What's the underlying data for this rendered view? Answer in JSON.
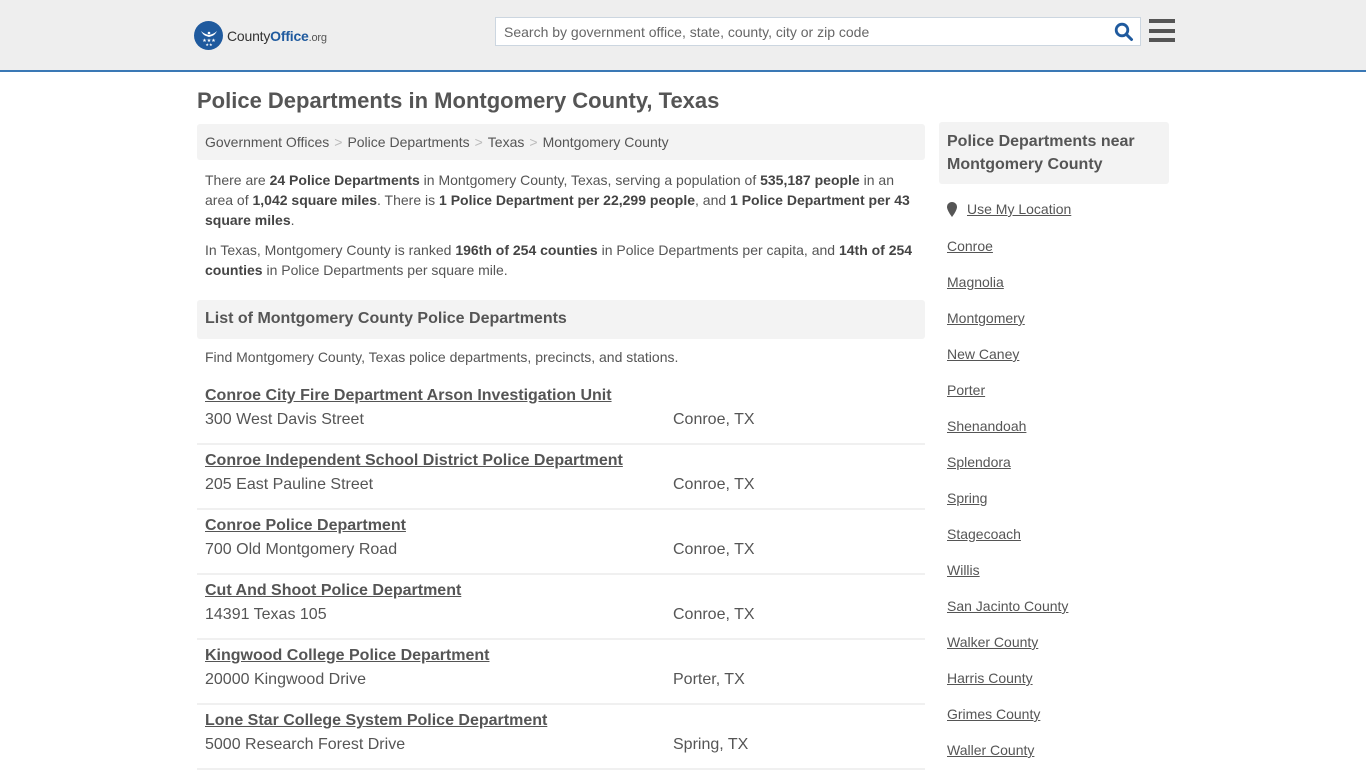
{
  "header": {
    "logo": {
      "name_part1": "County",
      "name_part2": "Office",
      "name_part3": ".org"
    },
    "search_placeholder": "Search by government office, state, county, city or zip code",
    "search_value": "",
    "colors": {
      "brand": "#1f5a9e",
      "header_border": "#3a78b5",
      "header_bg": "#eeeeee"
    }
  },
  "page_title": "Police Departments in Montgomery County, Texas",
  "breadcrumb": [
    {
      "label": "Government Offices"
    },
    {
      "label": "Police Departments"
    },
    {
      "label": "Texas"
    },
    {
      "label": "Montgomery County"
    }
  ],
  "breadcrumb_separator": ">",
  "intro": {
    "p1": {
      "t1": "There are ",
      "b1": "24 Police Departments",
      "t2": " in Montgomery County, Texas, serving a population of ",
      "b2": "535,187 people",
      "t3": " in an area of ",
      "b3": "1,042 square miles",
      "t4": ". There is ",
      "b4": "1 Police Department per 22,299 people",
      "t5": ", and ",
      "b5": "1 Police Department per 43 square miles",
      "t6": "."
    },
    "p2": {
      "t1": "In Texas, Montgomery County is ranked ",
      "b1": "196th of 254 counties",
      "t2": " in Police Departments per capita, and ",
      "b2": "14th of 254 counties",
      "t3": " in Police Departments per square mile."
    }
  },
  "list": {
    "title": "List of Montgomery County Police Departments",
    "description": "Find Montgomery County, Texas police departments, precincts, and stations.",
    "items": [
      {
        "name": "Conroe City Fire Department Arson Investigation Unit",
        "address": "300 West Davis Street",
        "city": "Conroe, TX"
      },
      {
        "name": "Conroe Independent School District Police Department",
        "address": "205 East Pauline Street",
        "city": "Conroe, TX"
      },
      {
        "name": "Conroe Police Department",
        "address": "700 Old Montgomery Road",
        "city": "Conroe, TX"
      },
      {
        "name": "Cut And Shoot Police Department",
        "address": "14391 Texas 105",
        "city": "Conroe, TX"
      },
      {
        "name": "Kingwood College Police Department",
        "address": "20000 Kingwood Drive",
        "city": "Porter, TX"
      },
      {
        "name": "Lone Star College System Police Department",
        "address": "5000 Research Forest Drive",
        "city": "Spring, TX"
      }
    ]
  },
  "sidebar": {
    "title": "Police Departments near Montgomery County",
    "use_location": "Use My Location",
    "links": [
      "Conroe",
      "Magnolia",
      "Montgomery",
      "New Caney",
      "Porter",
      "Shenandoah",
      "Splendora",
      "Spring",
      "Stagecoach",
      "Willis",
      "San Jacinto County",
      "Walker County",
      "Harris County",
      "Grimes County",
      "Waller County"
    ]
  }
}
